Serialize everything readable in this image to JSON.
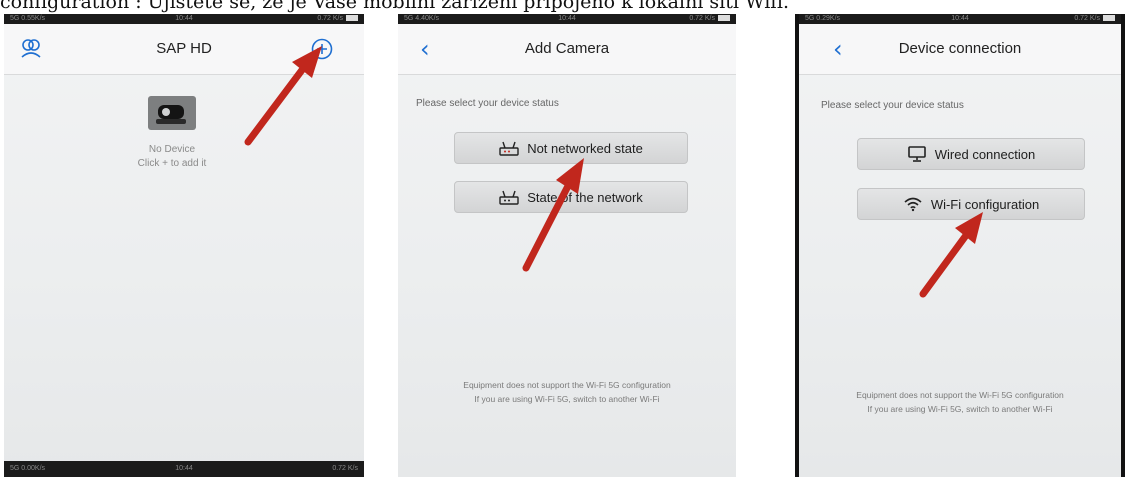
{
  "caption": "configuration : Ujistěte se, že je Vaše mobilní zařízení připojeno k lokální síti Wifi.",
  "screen1": {
    "status": {
      "left": "5G 0.55K/s",
      "time": "10:44",
      "right": "0.72 K/s"
    },
    "title": "SAP HD",
    "empty_line1": "No Device",
    "empty_line2": "Click + to add it",
    "bottom_status": {
      "left": "5G 0.00K/s",
      "time": "10:44",
      "right": "0.72 K/s"
    }
  },
  "screen2": {
    "status": {
      "left": "5G 4.40K/s",
      "time": "10:44",
      "right": "0.72 K/s"
    },
    "title": "Add Camera",
    "prompt": "Please select your device status",
    "buttons": [
      {
        "label": "Not networked state",
        "icon": "router-icon"
      },
      {
        "label": "State of the network",
        "icon": "router-icon"
      }
    ],
    "footer_line1": "Equipment does not support the Wi-Fi 5G configuration",
    "footer_line2": "If you are using Wi-Fi 5G, switch to another Wi-Fi"
  },
  "screen3": {
    "status": {
      "left": "5G 0.29K/s",
      "time": "10:44",
      "right": "0.72 K/s"
    },
    "title": "Device connection",
    "prompt": "Please select your device status",
    "buttons": [
      {
        "label": "Wired connection",
        "icon": "monitor-icon"
      },
      {
        "label": "Wi-Fi configuration",
        "icon": "wifi-icon"
      }
    ],
    "footer_line1": "Equipment does not support the Wi-Fi 5G configuration",
    "footer_line2": "If you are using Wi-Fi 5G, switch to another Wi-Fi"
  },
  "colors": {
    "accent": "#1f6fd1",
    "arrow": "#c1271d",
    "background": "#eceeef"
  }
}
